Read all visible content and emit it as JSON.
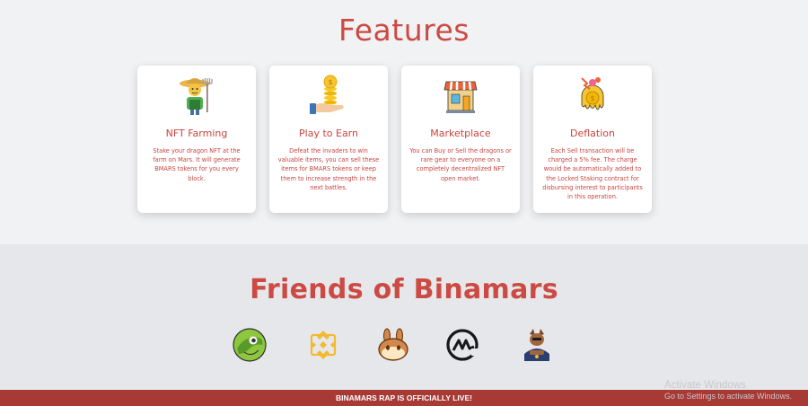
{
  "features": {
    "title": "Features",
    "cards": [
      {
        "icon": "farmer-icon",
        "title": "NFT Farming",
        "description": "Stake your dragon NFT at the farm on Mars. It will generate BMARS tokens for you every block."
      },
      {
        "icon": "coins-hand-icon",
        "title": "Play to Earn",
        "description": "Defeat the invaders to win valuable items, you can sell these items for BMARS tokens or keep them to increase strength in the next battles."
      },
      {
        "icon": "shop-icon",
        "title": "Marketplace",
        "description": "You can Buy or Sell the dragons or rare gear to everyone on a completely decentralized NFT open market."
      },
      {
        "icon": "melting-coin-icon",
        "title": "Deflation",
        "description": "Each Sell transaction will be charged a 5% fee. The charge would be automatically added to the Locked Staking contract for disbursing interest to participants in this operation."
      }
    ]
  },
  "friends": {
    "title": "Friends of Binamars",
    "partners": [
      "coingecko-logo",
      "binance-logo",
      "pancakeswap-logo",
      "coinmarketcap-logo",
      "guard-dog-logo"
    ]
  },
  "banner": {
    "text": "BINAMARS RAP IS OFFICIALLY LIVE!"
  },
  "watermark": {
    "line1": "Activate Windows",
    "line2": "Go to Settings to activate Windows."
  },
  "colors": {
    "accent": "#cc4a43",
    "banner": "#a83a36",
    "features_bg": "#f1f2f4",
    "friends_bg": "#e6e7ea"
  }
}
